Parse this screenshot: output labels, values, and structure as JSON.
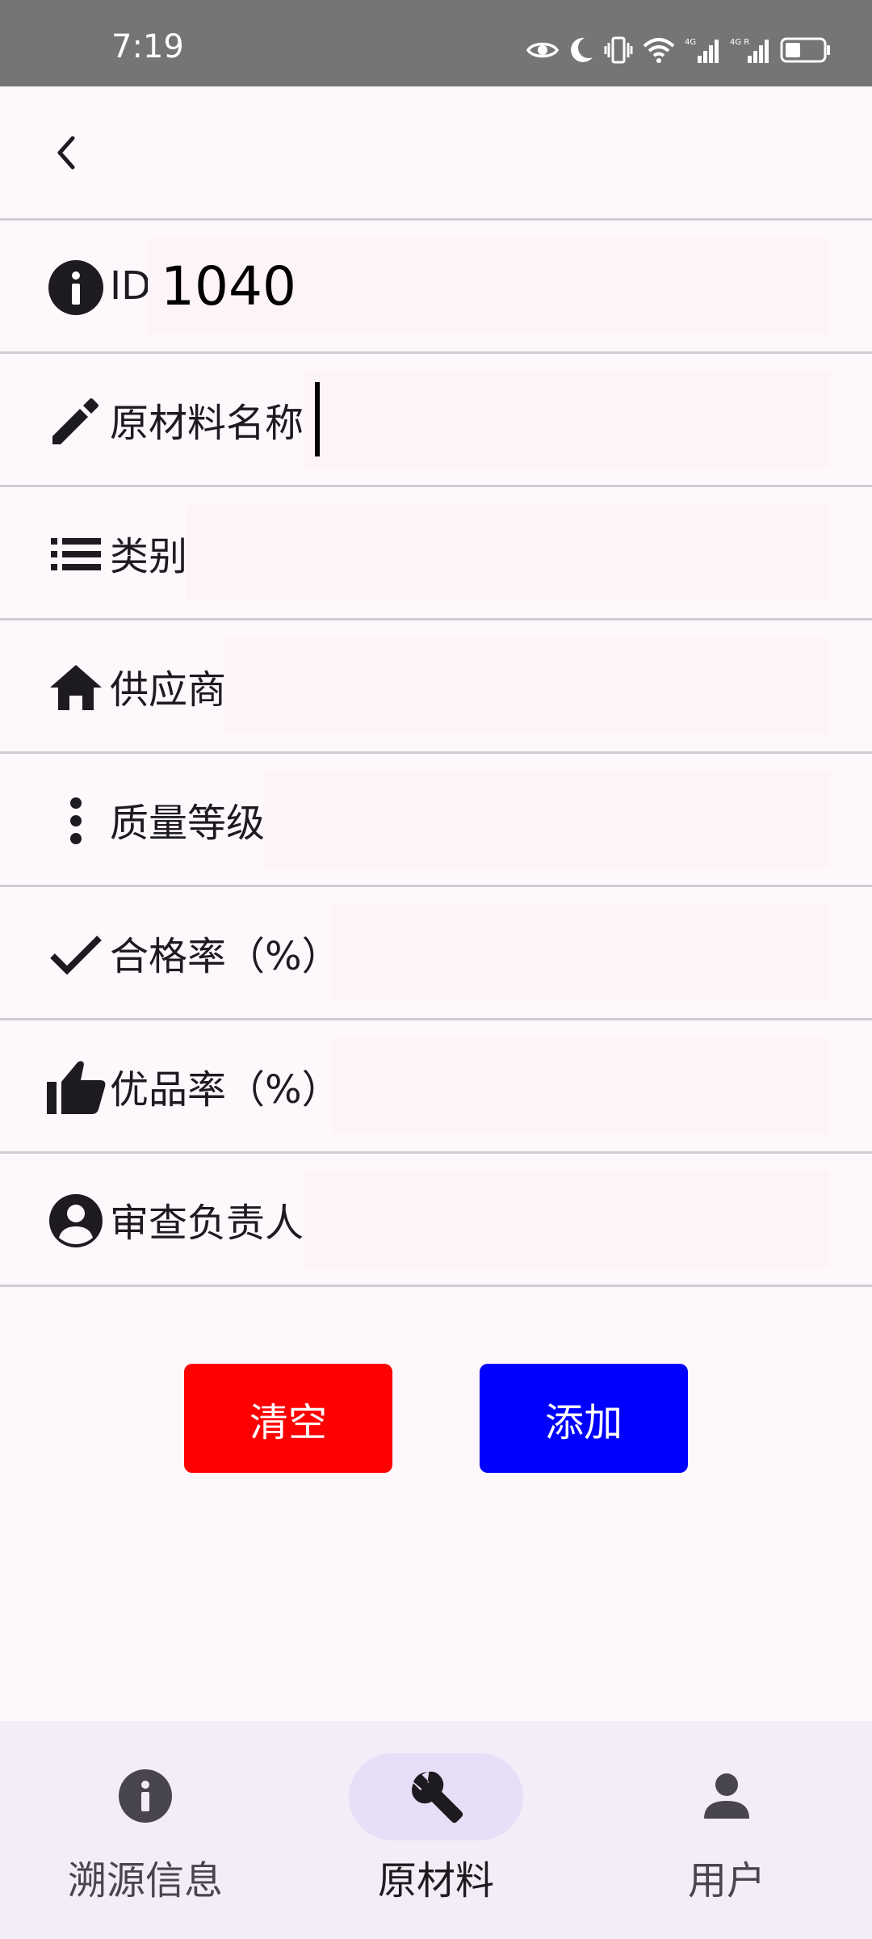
{
  "status_bar": {
    "time": "7:19",
    "icons": [
      "eye-icon",
      "moon-icon",
      "vibrate-icon",
      "wifi-icon",
      "signal-4g-icon",
      "signal-4g-r-icon",
      "battery-icon"
    ]
  },
  "app_bar": {
    "back_icon": "chevron-left-icon"
  },
  "form": {
    "rows": [
      {
        "icon": "info-icon",
        "label": "ID",
        "value": "1040"
      },
      {
        "icon": "pencil-icon",
        "label": "原材料名称",
        "value": ""
      },
      {
        "icon": "list-icon",
        "label": "类别",
        "value": ""
      },
      {
        "icon": "home-icon",
        "label": "供应商",
        "value": ""
      },
      {
        "icon": "more-vert-icon",
        "label": "质量等级",
        "value": ""
      },
      {
        "icon": "check-icon",
        "label": "合格率（%）",
        "value": ""
      },
      {
        "icon": "thumb-up-icon",
        "label": "优品率（%）",
        "value": ""
      },
      {
        "icon": "account-circle-icon",
        "label": "审查负责人",
        "value": ""
      }
    ]
  },
  "buttons": {
    "clear_label": "清空",
    "add_label": "添加",
    "clear_color": "#ff0000",
    "add_color": "#0000ff"
  },
  "bottom_nav": {
    "items": [
      {
        "label": "溯源信息",
        "icon": "info-icon",
        "active": false
      },
      {
        "label": "原材料",
        "icon": "wrench-icon",
        "active": true
      },
      {
        "label": "用户",
        "icon": "person-icon",
        "active": false
      }
    ]
  }
}
